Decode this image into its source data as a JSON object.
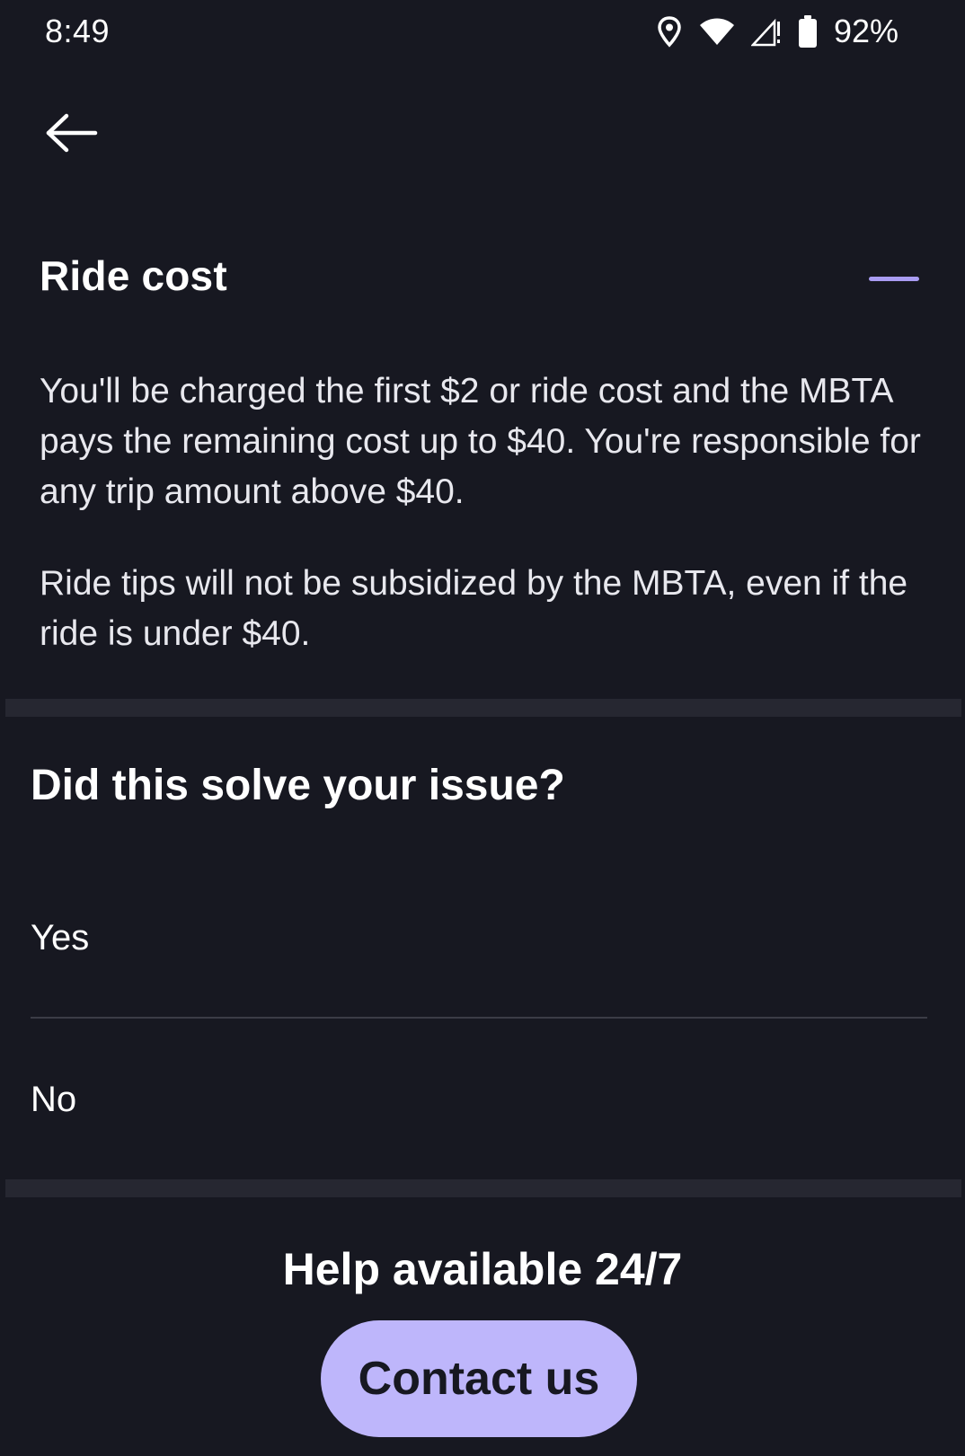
{
  "status_bar": {
    "time": "8:49",
    "battery_percent": "92%",
    "icons": [
      "location-icon",
      "wifi-icon",
      "signal-icon",
      "battery-icon"
    ]
  },
  "header": {
    "back_icon": "arrow-left-icon"
  },
  "section": {
    "title": "Ride cost",
    "collapse_icon": "minus-icon",
    "accent_color": "#a99cf2",
    "paragraphs": [
      "You'll be charged the first $2 or ride cost and the MBTA pays the remaining cost up to $40. You're responsible for any trip amount above $40.",
      "Ride tips will not be subsidized by the MBTA, even if the ride is under $40."
    ]
  },
  "feedback": {
    "question": "Did this solve your issue?",
    "options": [
      "Yes",
      "No"
    ]
  },
  "help": {
    "title": "Help available 24/7",
    "contact_label": "Contact us",
    "button_color": "#beb6fb"
  },
  "colors": {
    "background": "#171821",
    "divider": "#262731"
  }
}
